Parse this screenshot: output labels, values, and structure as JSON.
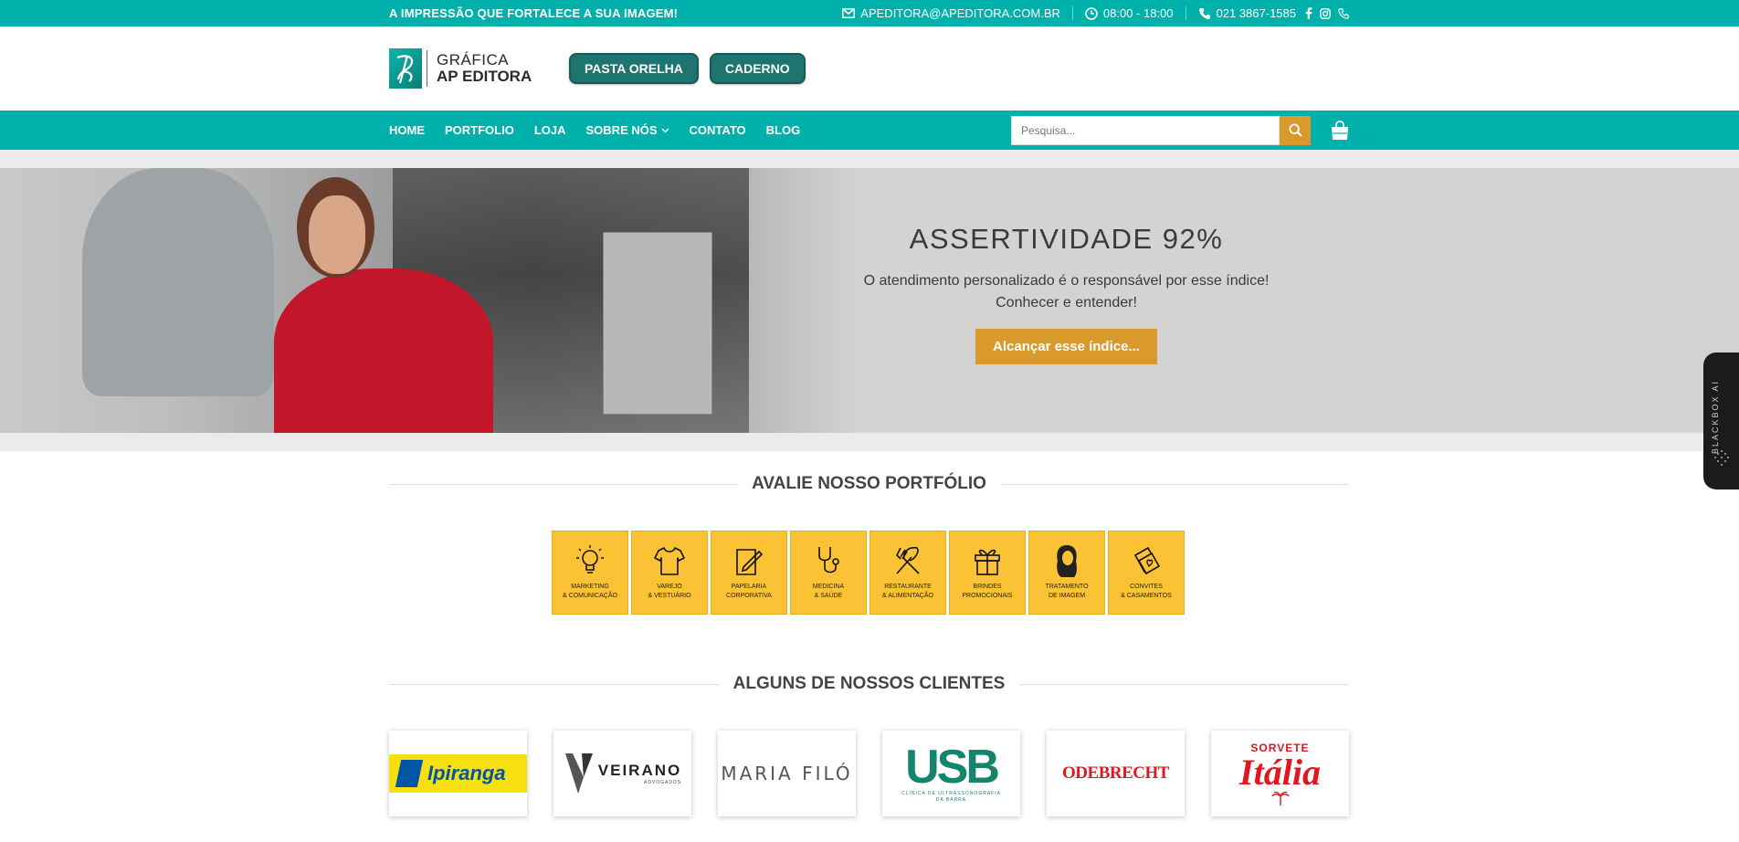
{
  "topbar": {
    "tagline": "A IMPRESSÃO QUE FORTALECE A SUA IMAGEM!",
    "email": "APEDITORA@APEDITORA.COM.BR",
    "hours": "08:00 - 18:00",
    "phone": "021 3867-1585",
    "social": [
      "facebook-icon",
      "instagram-icon",
      "phone-icon"
    ]
  },
  "header": {
    "logo_line1": "GRÁFICA",
    "logo_line2": "AP EDITORA",
    "buttons": [
      "PASTA ORELHA",
      "CADERNO"
    ]
  },
  "nav": {
    "items": [
      "HOME",
      "PORTFOLIO",
      "LOJA",
      "SOBRE NÓS",
      "CONTATO",
      "BLOG"
    ],
    "search_placeholder": "Pesquisa..."
  },
  "hero": {
    "title": "ASSERTIVIDADE 92%",
    "line1": "O atendimento personalizado é o responsável por esse índice!",
    "line2": "Conhecer e entender!",
    "button": "Alcançar esse índice..."
  },
  "portfolio": {
    "title": "AVALIE NOSSO PORTFÓLIO",
    "tiles": [
      {
        "label": "MARKETING\n& COMUNICAÇÃO",
        "icon": "lightbulb-icon"
      },
      {
        "label": "VAREJO\n& VESTUÁRIO",
        "icon": "tshirt-icon"
      },
      {
        "label": "PAPELARIA\nCORPORATIVA",
        "icon": "notepad-pen-icon"
      },
      {
        "label": "MEDICINA\n& SAÚDE",
        "icon": "stethoscope-icon"
      },
      {
        "label": "RESTAURANTE\n& ALIMENTAÇÃO",
        "icon": "fork-knife-icon"
      },
      {
        "label": "BRINDES\nPROMOCIONAIS",
        "icon": "gift-icon"
      },
      {
        "label": "TRATAMENTO\nDE IMAGEM",
        "icon": "portrait-icon"
      },
      {
        "label": "CONVITES\n& CASAMENTOS",
        "icon": "invitation-icon"
      }
    ]
  },
  "clients": {
    "title": "ALGUNS DE NOSSOS CLIENTES",
    "logos": [
      "Ipiranga",
      "VEIRANO",
      "ADVOGADOS",
      "MARIA FILÓ",
      "USB",
      "CLÍNICA DE ULTRASSONOGRAFIA DA BARRA",
      "ODEBRECHT",
      "SORVETE",
      "Itália"
    ]
  },
  "widget": {
    "label": "BLACKBOX AI"
  },
  "colors": {
    "teal": "#00b1ab",
    "dark_teal": "#1f7470",
    "gold": "#d99a2b",
    "tile_yellow": "#fcc235"
  }
}
